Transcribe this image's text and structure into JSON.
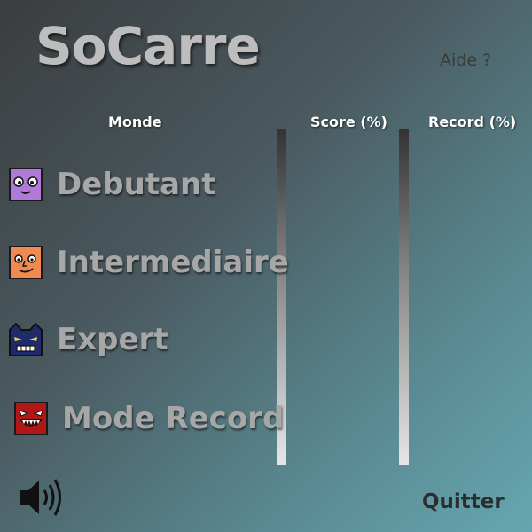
{
  "title": "SoCarre",
  "help_label": "Aide ?",
  "columns": {
    "world": "Monde",
    "score": "Score (%)",
    "record": "Record (%)"
  },
  "worlds": [
    {
      "label": "Debutant",
      "icon": "purple-smile-face-icon",
      "color": "#b07ad8"
    },
    {
      "label": "Intermediaire",
      "icon": "orange-face-icon",
      "color": "#f08a50"
    },
    {
      "label": "Expert",
      "icon": "dark-blue-angry-face-icon",
      "color": "#1e2a6a"
    },
    {
      "label": "Mode Record",
      "icon": "red-monster-face-icon",
      "color": "#b01818"
    }
  ],
  "sound_icon": "speaker-icon",
  "quit_label": "Quitter"
}
